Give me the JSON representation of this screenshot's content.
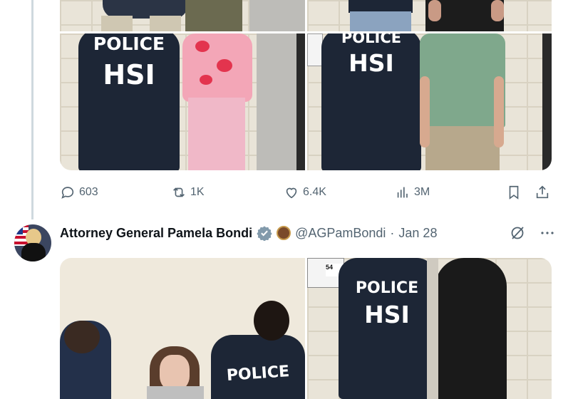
{
  "previous_tweet": {
    "stats": {
      "replies": "603",
      "reposts": "1K",
      "likes": "6.4K",
      "views": "3M"
    },
    "photo_labels": {
      "police": "POLICE",
      "hsi": "HSI"
    }
  },
  "tweet": {
    "author_name": "Attorney General Pamela Bondi",
    "handle": "@AGPamBondi",
    "separator": "·",
    "date": "Jan 28",
    "photo_labels": {
      "police": "POLICE",
      "hsi": "HSI",
      "tag": "54"
    }
  },
  "icons": {
    "reply": "comment-bubble-icon",
    "repost": "repost-arrows-icon",
    "like": "heart-icon",
    "views": "bar-chart-icon",
    "bookmark": "bookmark-icon",
    "share": "share-upload-icon",
    "verified": "verified-badge-icon",
    "affiliate": "doj-seal-icon",
    "grok": "grok-icon",
    "more": "more-dots-icon"
  },
  "colors": {
    "text": "#0f1419",
    "muted": "#536471",
    "verified_badge": "#829aab",
    "thread_line": "#cfd9de",
    "jacket": "#1d2636"
  }
}
